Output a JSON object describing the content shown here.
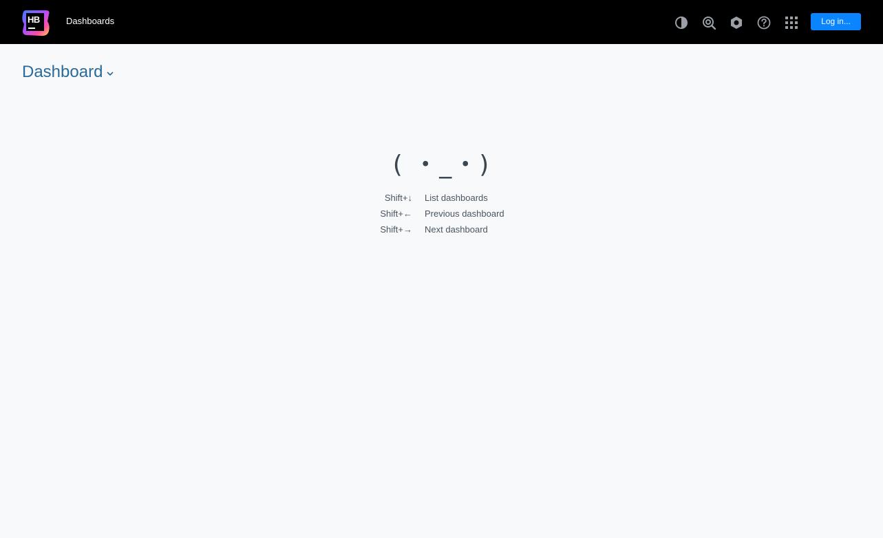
{
  "header": {
    "logo_text": "HB",
    "title": "Dashboards",
    "login_label": "Log in...",
    "icons": [
      "theme-toggle-icon",
      "search-icon",
      "settings-icon",
      "help-icon",
      "apps-grid-icon"
    ],
    "colors": {
      "topbar_bg": "#000000",
      "login_bg": "#0a84ff",
      "icon_color": "#9aa0a6"
    }
  },
  "main": {
    "dashboard_selector": {
      "label": "Dashboard",
      "color": "#2b6a99"
    },
    "empty_state": {
      "face": "( ・_・)",
      "shortcuts": [
        {
          "key": "Shift+↓",
          "description": "List dashboards"
        },
        {
          "key": "Shift+←",
          "description": "Previous dashboard"
        },
        {
          "key": "Shift+→",
          "description": "Next dashboard"
        }
      ]
    }
  }
}
